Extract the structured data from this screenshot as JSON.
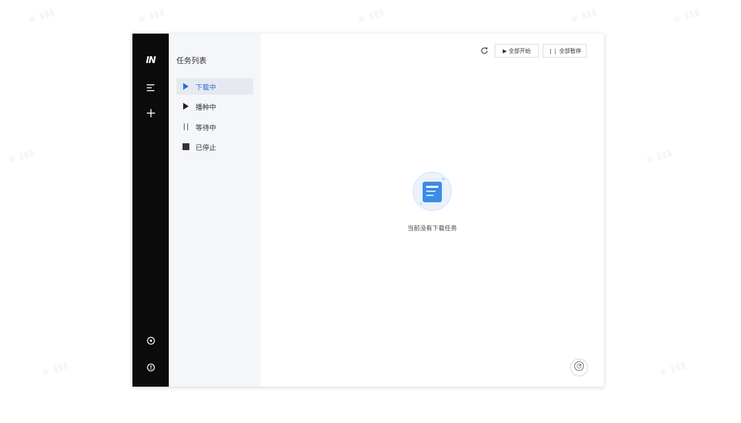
{
  "app": {
    "logo": "IN"
  },
  "sidebar": {
    "title": "任务列表",
    "items": [
      {
        "label": "下载中",
        "icon": "play-icon",
        "active": true
      },
      {
        "label": "播种中",
        "icon": "play-icon",
        "active": false
      },
      {
        "label": "等待中",
        "icon": "pause-icon",
        "active": false
      },
      {
        "label": "已停止",
        "icon": "stop-icon",
        "active": false
      }
    ]
  },
  "toolbar": {
    "start_all_label": "▶ 全部开始",
    "pause_all_label": "❘❘ 全部暂停"
  },
  "main": {
    "empty_message": "当前没有下载任务"
  },
  "colors": {
    "accent": "#2b6fd8",
    "rail_bg": "#0b0b0b",
    "panel_bg": "#f4f6f9"
  }
}
